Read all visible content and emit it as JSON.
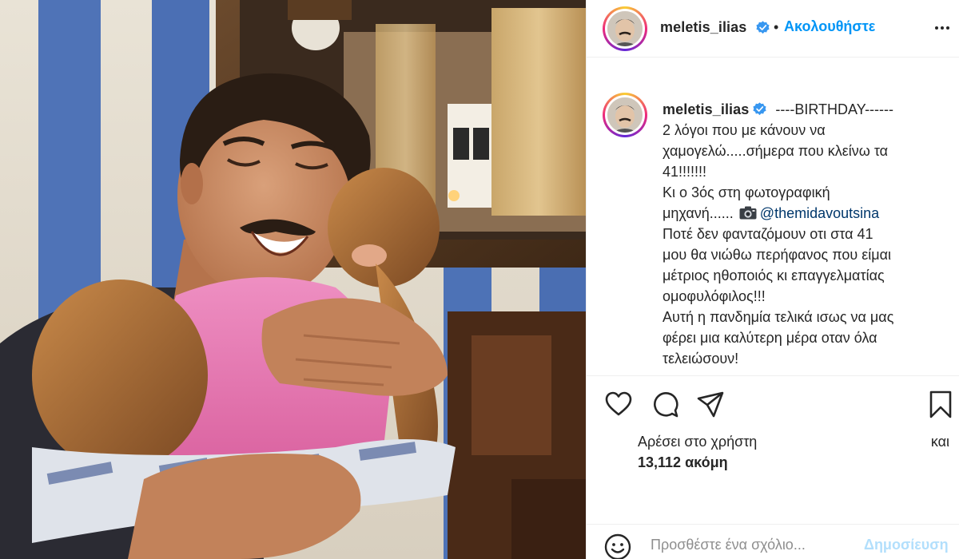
{
  "post": {
    "username": "meletis_ilias",
    "follow_separator": "•",
    "follow_label": "Ακολουθήστε",
    "caption": {
      "username": "meletis_ilias",
      "first_line": "----BIRTHDAY------",
      "lines": [
        "2 λόγοι που με κάνουν να",
        "χαμογελώ.....σήμερα που κλείνω τα",
        "41!!!!!!!",
        "Κι ο 3ός στη φωτογραφική"
      ],
      "mention_prefix": "μηχανή......",
      "mention": "@themidavoutsina",
      "lines_after": [
        "Ποτέ δεν φανταζόμουν οτι στα 41",
        "μου θα νιώθω περήφανος που είμαι",
        "μέτριος ηθοποιός κι επαγγελματίας",
        "ομοφυλόφιλος!!!",
        "Αυτή η πανδημία τελικά ισως να μας",
        "φέρει μια καλύτερη μέρα οταν όλα",
        "τελειώσουν!"
      ]
    },
    "likes": {
      "prefix": "Αρέσει στο χρήστη",
      "conjunction": "και",
      "count": "13,112 ακόμη"
    },
    "comment": {
      "placeholder": "Προσθέστε ένα σχόλιο...",
      "post_label": "Δημοσίευση"
    }
  },
  "icons": {
    "verified": "verified-badge-icon",
    "more": "more-options-icon",
    "like": "heart-icon",
    "comment": "comment-bubble-icon",
    "share": "paper-plane-icon",
    "save": "bookmark-icon",
    "emoji": "smiley-icon",
    "camera": "camera-emoji-icon"
  },
  "colors": {
    "link": "#0095f6",
    "mention": "#00376b",
    "post_disabled": "#b2dffc",
    "muted": "#8e8e8e"
  }
}
